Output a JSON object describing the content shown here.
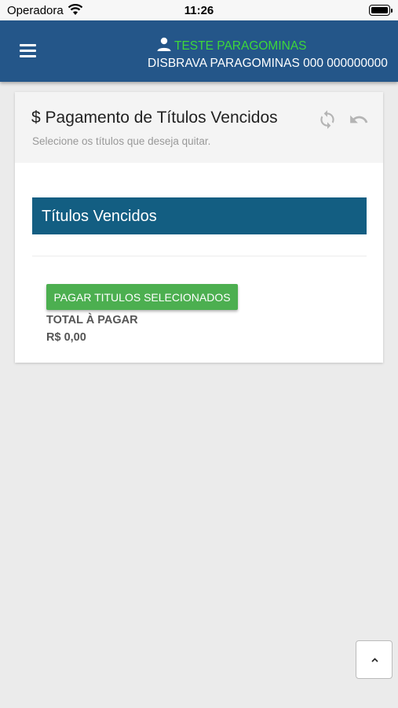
{
  "status_bar": {
    "carrier": "Operadora",
    "time": "11:26",
    "wifi_icon": "wifi-icon",
    "battery_icon": "battery-icon"
  },
  "header": {
    "menu_icon": "hamburger-menu-icon",
    "user_icon": "person-icon",
    "user_name": "TESTE PARAGOMINAS",
    "company": "DISBRAVA PARAGOMINAS 000 000000000",
    "colors": {
      "background": "#245689",
      "user_name": "#3ed83a"
    }
  },
  "card": {
    "title": "$ Pagamento de Títulos Vencidos",
    "subtitle": "Selecione os títulos que deseja quitar.",
    "refresh_icon": "refresh-icon",
    "undo_icon": "undo-icon",
    "section_title": "Títulos Vencidos",
    "section_color": "#135e82",
    "pay_button_label": "PAGAR TITULOS SELECIONADOS",
    "pay_button_color": "#4caf50",
    "total_label": "TOTAL À PAGAR",
    "total_value": "R$ 0,00"
  },
  "scroll_top": {
    "icon": "chevron-up-icon"
  }
}
